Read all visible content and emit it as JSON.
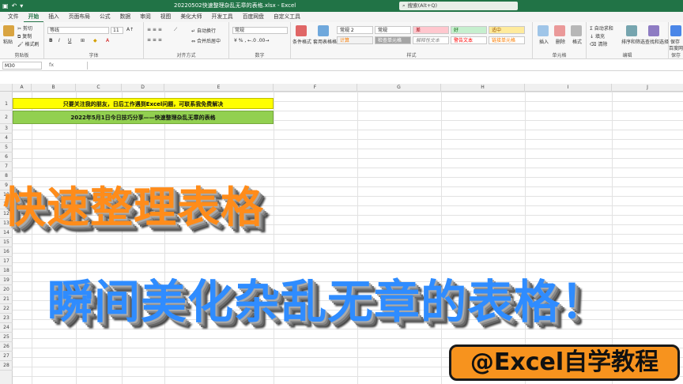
{
  "titlebar": {
    "title": "20220502快速整理杂乱无章的表格.xlsx  -  Excel",
    "search_placeholder": "搜索(Alt+Q)"
  },
  "tabs": [
    "文件",
    "开始",
    "插入",
    "页面布局",
    "公式",
    "数据",
    "审阅",
    "视图",
    "美化大师",
    "开发工具",
    "百度网盘",
    "自定义工具"
  ],
  "ribbon": {
    "clipboard": {
      "paste": "粘贴",
      "cut": "剪切",
      "copy": "复制",
      "format_painter": "格式刷",
      "label": "剪贴板"
    },
    "font": {
      "name": "等线",
      "size": "11",
      "label": "字体"
    },
    "alignment": {
      "wrap": "自动换行",
      "merge": "合并后居中",
      "label": "对齐方式"
    },
    "number": {
      "format": "常规",
      "label": "数字"
    },
    "styles": {
      "conditional": "条件格式",
      "table_format": "套用表格格式",
      "cells": [
        "常规 2",
        "常规",
        "差",
        "好",
        "适中",
        "计算",
        "检查单元格",
        "解释性文本",
        "警告文本",
        "链接单元格"
      ],
      "label": "样式"
    },
    "cells": {
      "insert": "插入",
      "delete": "删除",
      "format": "格式",
      "label": "单元格"
    },
    "editing": {
      "autosum": "自动求和",
      "fill": "填充",
      "clear": "清除",
      "sort_filter": "排序和筛选",
      "find_select": "查找和选择",
      "label": "编辑"
    },
    "extra": {
      "label1": "保存",
      "label2": "百度网盘",
      "label3": "保存"
    }
  },
  "formula_bar": {
    "name_box": "M30",
    "fx": "fx"
  },
  "columns": [
    "A",
    "B",
    "C",
    "D",
    "E",
    "F",
    "G",
    "H",
    "I",
    "J"
  ],
  "rows": [
    "1",
    "2",
    "3",
    "4",
    "5",
    "6",
    "7",
    "8",
    "9",
    "10",
    "11",
    "12",
    "13",
    "14",
    "15",
    "16",
    "17",
    "18",
    "19",
    "20",
    "21",
    "22",
    "23",
    "24",
    "25",
    "26",
    "27",
    "28"
  ],
  "sheet": {
    "row1": "只要关注我的朋友，日后工作遇到Excel问题，可联系我免费解决",
    "row2": "2022年5月1日今日技巧分享——快速整理杂乱无章的表格"
  },
  "overlay": {
    "headline1": "快速整理表格",
    "headline2": "瞬间美化杂乱无章的表格！",
    "badge": "@Excel自学教程"
  },
  "colors": {
    "excel_green": "#217346",
    "row1_bg": "#ffff00",
    "row2_bg": "#92d050",
    "headline1": "#ff8c1a",
    "headline2": "#2f8cff",
    "badge_bg": "#f7931e"
  }
}
